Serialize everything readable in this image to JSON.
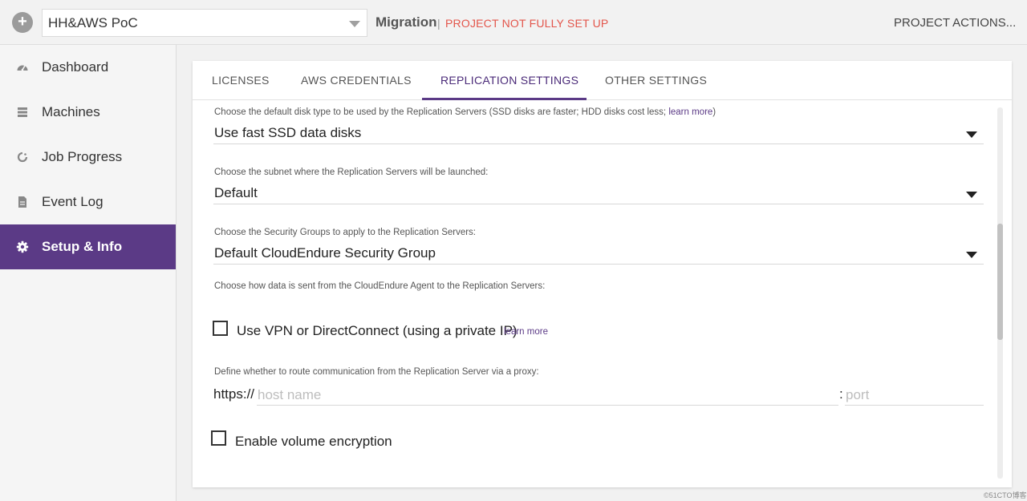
{
  "topbar": {
    "add_label": "+",
    "project": "HH&AWS PoC",
    "mode": "Migration",
    "separator": "|",
    "warning": "PROJECT NOT FULLY SET UP",
    "actions": "PROJECT ACTIONS..."
  },
  "sidebar": {
    "items": [
      {
        "label": "Dashboard",
        "icon": "dashboard-icon"
      },
      {
        "label": "Machines",
        "icon": "machines-icon"
      },
      {
        "label": "Job Progress",
        "icon": "job-progress-icon"
      },
      {
        "label": "Event Log",
        "icon": "event-log-icon"
      },
      {
        "label": "Setup & Info",
        "icon": "gear-icon",
        "active": true
      }
    ]
  },
  "tabs": [
    {
      "label": "LICENSES"
    },
    {
      "label": "AWS CREDENTIALS"
    },
    {
      "label": "REPLICATION SETTINGS",
      "active": true
    },
    {
      "label": "OTHER SETTINGS"
    }
  ],
  "settings": {
    "disk": {
      "label": "Choose the default disk type to be used by the Replication Servers (SSD disks are faster; HDD disks cost less;",
      "learn_more": "learn more",
      "close_paren": ")",
      "value": "Use fast SSD data disks"
    },
    "subnet": {
      "label": "Choose the subnet where the Replication Servers will be launched:",
      "value": "Default"
    },
    "security_groups": {
      "label": "Choose the Security Groups to apply to the Replication Servers:",
      "value": "Default CloudEndure Security Group"
    },
    "data_route": {
      "label": "Choose how data is sent from the CloudEndure Agent to the Replication Servers:",
      "vpn_label": "Use VPN or DirectConnect (using a private IP)",
      "vpn_checked": false,
      "learn_more": "learn more"
    },
    "proxy": {
      "label": "Define whether to route communication from the Replication Server via a proxy:",
      "scheme": "https://",
      "host_placeholder": "host name",
      "host_value": "",
      "colon": ":",
      "port_placeholder": "port",
      "port_value": ""
    },
    "encryption": {
      "label": "Enable volume encryption",
      "checked": false
    }
  },
  "watermark": "©51CTO博客",
  "colors": {
    "accent": "#5b3a86",
    "warning": "#e3554b"
  }
}
